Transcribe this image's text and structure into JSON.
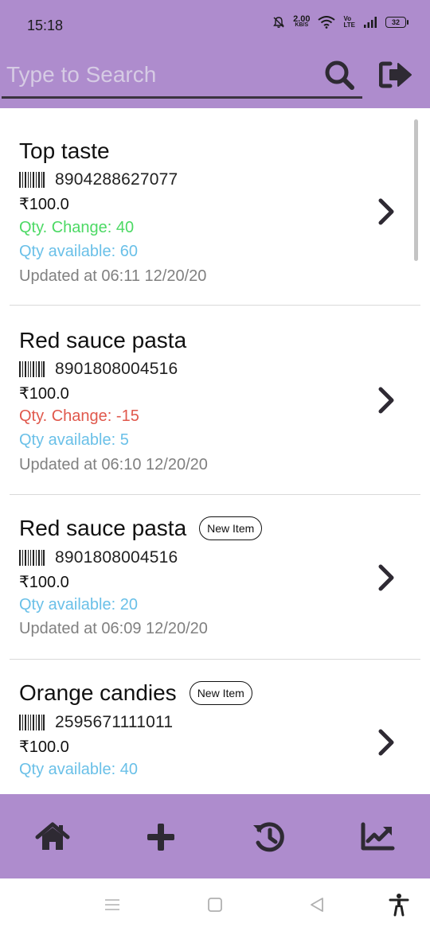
{
  "status_bar": {
    "time": "15:18",
    "net_speed_value": "2.00",
    "net_speed_unit": "KB/S",
    "volte_top": "Vo",
    "volte_bottom": "LTE",
    "battery": "32"
  },
  "search": {
    "placeholder": "Type to Search",
    "value": ""
  },
  "icons": {
    "search": "search-icon",
    "logout": "sign-out-icon",
    "barcode": "barcode-icon",
    "chevron": "chevron-right-icon",
    "home": "home-icon",
    "add": "plus-icon",
    "history": "history-icon",
    "analytics": "chart-line-icon"
  },
  "colors": {
    "header_bg": "#ae8ccd",
    "qty_positive": "#4cd964",
    "qty_negative": "#e0584c",
    "qty_available": "#6ac0e8",
    "updated_text": "#808080"
  },
  "items": [
    {
      "name": "Top taste",
      "barcode": "8904288627077",
      "price": "₹100.0",
      "qty_change": "Qty. Change: 40",
      "qty_available": "Qty available: 60",
      "updated": "Updated at 06:11 12/20/20"
    },
    {
      "name": "Red sauce pasta",
      "barcode": "8901808004516",
      "price": "₹100.0",
      "qty_change": "Qty. Change: -15",
      "qty_available": "Qty available: 5",
      "updated": "Updated at 06:10 12/20/20"
    },
    {
      "name": "Red sauce pasta",
      "badge": "New Item",
      "barcode": "8901808004516",
      "price": "₹100.0",
      "qty_available": "Qty available: 20",
      "updated": "Updated at 06:09 12/20/20"
    },
    {
      "name": "Orange candies",
      "badge": "New Item",
      "barcode": "2595671111011",
      "price": "₹100.0",
      "qty_available": "Qty available: 40"
    }
  ]
}
